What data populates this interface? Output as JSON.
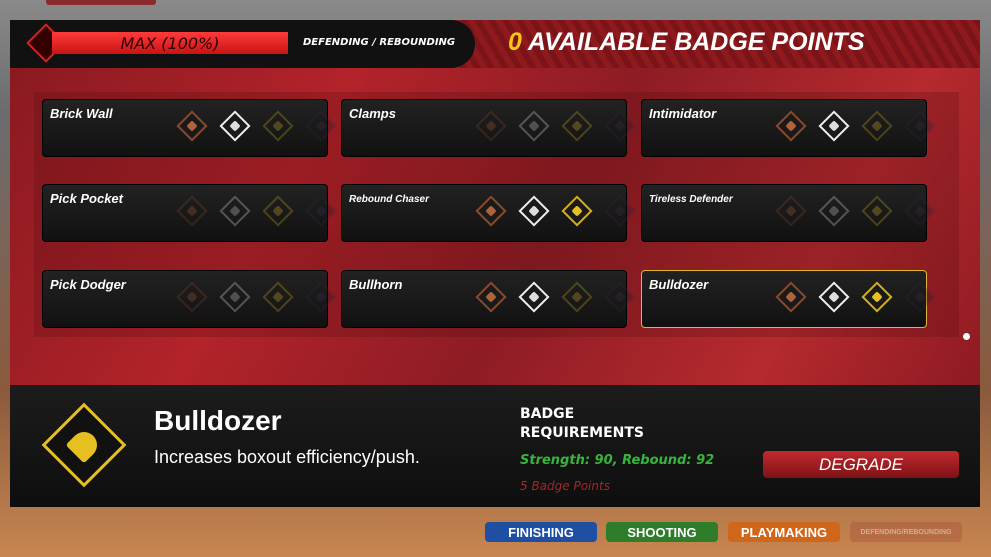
{
  "header": {
    "progress_label": "MAX (100%)",
    "progress_percent": 100,
    "category": "DEFENDING / REBOUNDING",
    "points_value": "0",
    "points_label": "AVAILABLE BADGE POINTS"
  },
  "badges": [
    {
      "name": "Brick Wall",
      "tiers": [
        "bronze",
        "silver"
      ]
    },
    {
      "name": "Clamps",
      "tiers": []
    },
    {
      "name": "Intimidator",
      "tiers": [
        "bronze",
        "silver"
      ]
    },
    {
      "name": "Pick Pocket",
      "tiers": []
    },
    {
      "name": "Rebound Chaser",
      "tiers": [
        "bronze",
        "silver",
        "gold"
      ]
    },
    {
      "name": "Tireless Defender",
      "tiers": []
    },
    {
      "name": "Pick Dodger",
      "tiers": []
    },
    {
      "name": "Bullhorn",
      "tiers": [
        "bronze",
        "silver"
      ]
    },
    {
      "name": "Bulldozer",
      "tiers": [
        "bronze",
        "silver",
        "gold"
      ],
      "selected": true
    }
  ],
  "detail": {
    "icon": "hard-hat-icon",
    "title": "Bulldozer",
    "description": "Increases boxout efficiency/push.",
    "req_heading": "BADGE REQUIREMENTS",
    "requirements": "Strength: 90, Rebound: 92",
    "cost": "5 Badge Points",
    "button": "DEGRADE"
  },
  "tabs": [
    {
      "label": "FINISHING",
      "color": "#1f4fa3"
    },
    {
      "label": "SHOOTING",
      "color": "#2f7d2a"
    },
    {
      "label": "PLAYMAKING",
      "color": "#d0661a"
    },
    {
      "label": "DEFENDING/REBOUNDING",
      "color": "#a34a3a",
      "active": true
    }
  ]
}
